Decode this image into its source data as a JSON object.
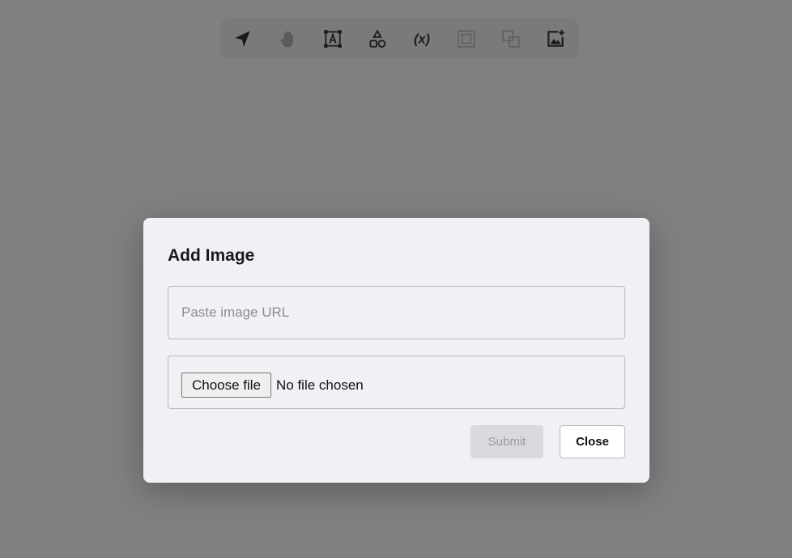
{
  "toolbar": {
    "tools": [
      {
        "name": "select",
        "icon": "navigation-arrow-icon",
        "disabled": false
      },
      {
        "name": "pan",
        "icon": "hand-icon",
        "disabled": false
      },
      {
        "name": "text",
        "icon": "text-box-icon",
        "disabled": false
      },
      {
        "name": "shapes",
        "icon": "shapes-icon",
        "disabled": false
      },
      {
        "name": "variable",
        "icon": "variable-icon",
        "disabled": false,
        "glyph": "(x)"
      },
      {
        "name": "group",
        "icon": "group-icon",
        "disabled": true
      },
      {
        "name": "ungroup",
        "icon": "ungroup-icon",
        "disabled": true
      },
      {
        "name": "add-image",
        "icon": "add-image-icon",
        "disabled": false
      }
    ]
  },
  "modal": {
    "title": "Add Image",
    "url_placeholder": "Paste image URL",
    "url_value": "",
    "choose_file_label": "Choose file",
    "file_status": "No file chosen",
    "submit_label": "Submit",
    "close_label": "Close"
  },
  "colors": {
    "overlay": "#808080",
    "modal_bg": "#f0f1f5",
    "submit_disabled_bg": "#d9dadd"
  }
}
